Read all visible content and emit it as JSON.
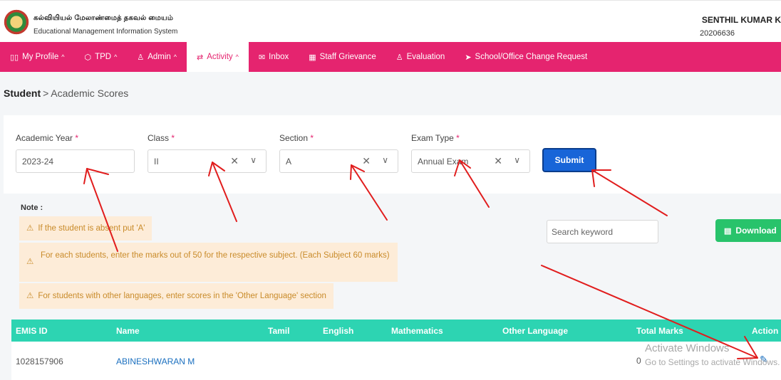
{
  "header": {
    "tamil_title": "கல்வியியல் மேலாண்மைத் தகவல் மையம்",
    "system_title": "Educational Management Information System",
    "user_name": "SENTHIL KUMAR K",
    "user_id": "20206636"
  },
  "nav": {
    "items": [
      {
        "label": "My Profile",
        "icon": "book-icon",
        "caret": "^"
      },
      {
        "label": "TPD",
        "icon": "cube-icon",
        "caret": "^"
      },
      {
        "label": "Admin",
        "icon": "user-gear-icon",
        "caret": "^"
      },
      {
        "label": "Activity",
        "icon": "swap-icon",
        "caret": "^"
      },
      {
        "label": "Inbox",
        "icon": "mail-icon",
        "caret": ""
      },
      {
        "label": "Staff Grievance",
        "icon": "grid-icon",
        "caret": ""
      },
      {
        "label": "Evaluation",
        "icon": "person-icon",
        "caret": ""
      },
      {
        "label": "School/Office Change Request",
        "icon": "send-icon",
        "caret": ""
      }
    ],
    "active": "Activity",
    "accent": "#e5246f"
  },
  "breadcrumb": {
    "root": "Student",
    "separator": ">",
    "current": "Academic Scores"
  },
  "filters": {
    "academic_year": {
      "label": "Academic Year",
      "required": "*",
      "value": "2023-24"
    },
    "class": {
      "label": "Class",
      "required": "*",
      "value": "II"
    },
    "section": {
      "label": "Section",
      "required": "*",
      "value": "A"
    },
    "exam_type": {
      "label": "Exam Type",
      "required": "*",
      "value": "Annual Exam"
    },
    "submit_label": "Submit"
  },
  "notes": {
    "title": "Note :",
    "items": [
      "If the student is absent put 'A'",
      "For each students, enter the marks out of 50 for the respective subject. (Each Subject 60 marks)",
      "For students with other languages, enter scores in the 'Other Language' section"
    ]
  },
  "search": {
    "placeholder": "Search keyword"
  },
  "download_label": "Download",
  "table": {
    "columns": [
      "EMIS ID",
      "Name",
      "Tamil",
      "English",
      "Mathematics",
      "Other Language",
      "Total Marks",
      "Action"
    ],
    "rows": [
      {
        "emis_id": "1028157906",
        "name": "ABINESHWARAN M",
        "tamil": "",
        "english": "",
        "mathematics": "",
        "other_language": "",
        "total_marks": "0",
        "action": "edit"
      }
    ],
    "header_color": "#2dd4b2"
  },
  "watermark": {
    "line1": "Activate Windows",
    "line2": "Go to Settings to activate Windows."
  }
}
